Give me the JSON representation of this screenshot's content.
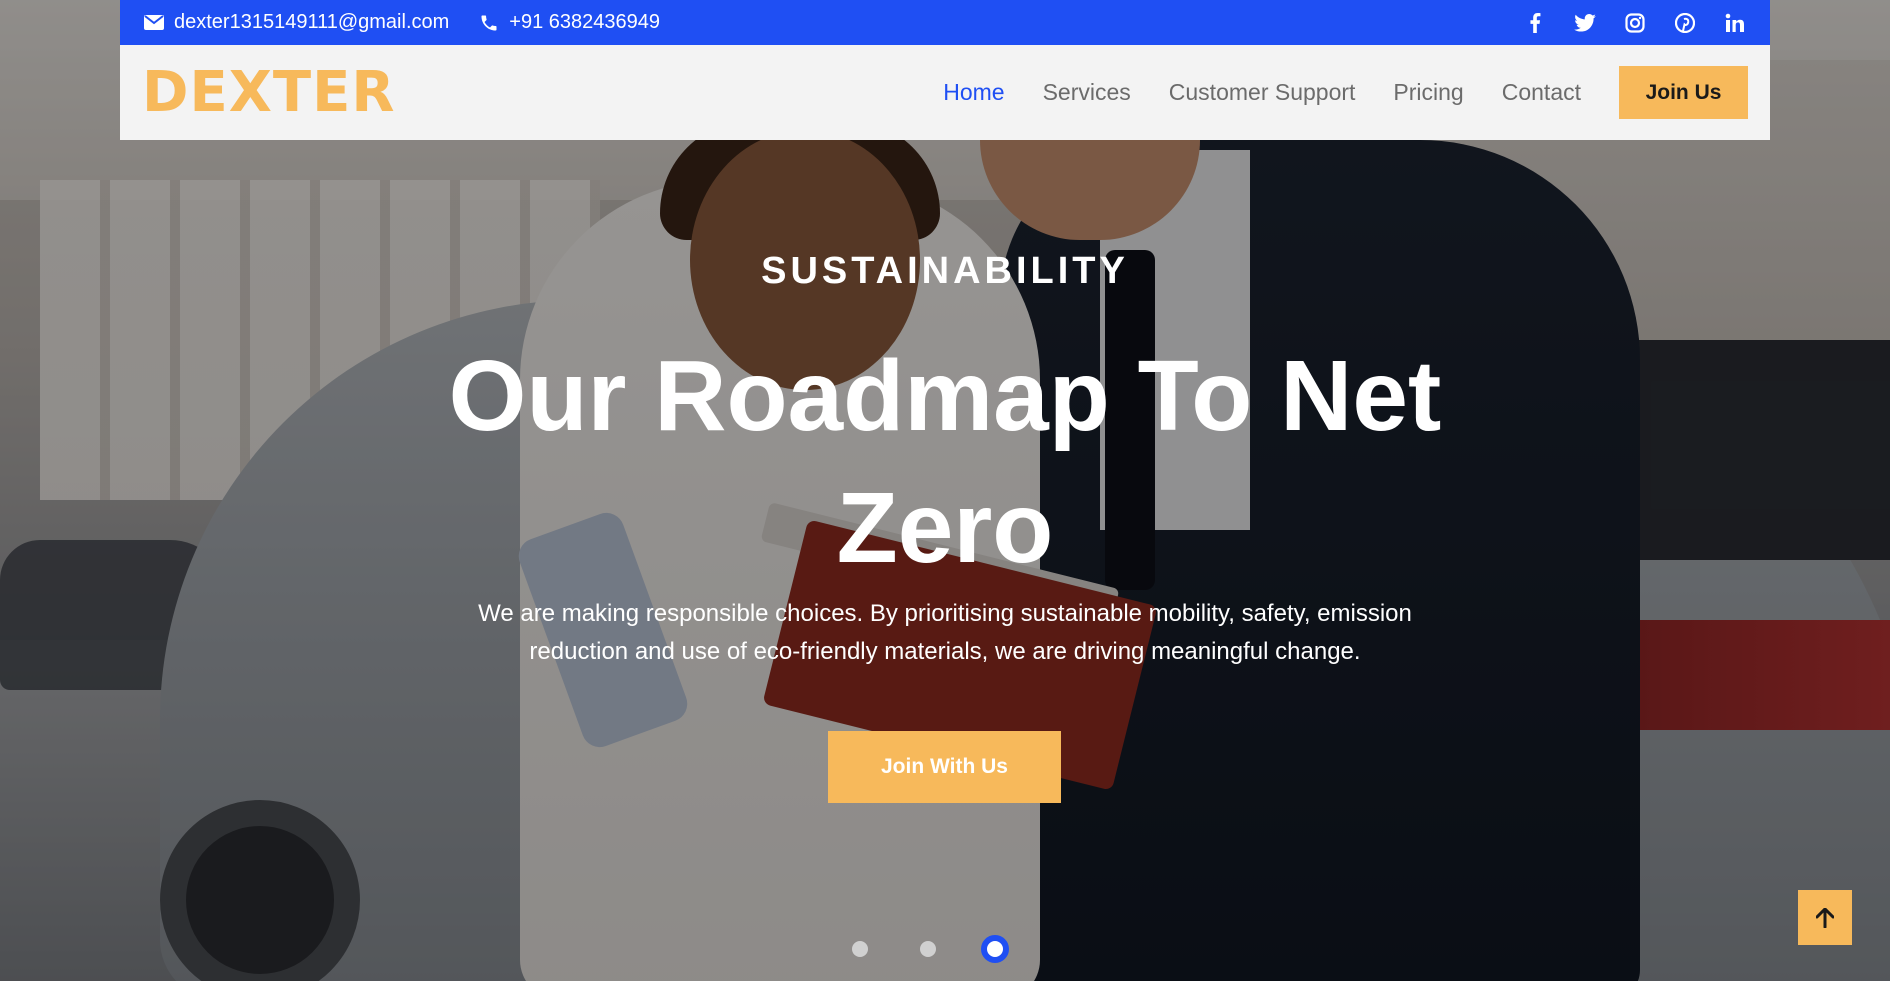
{
  "topbar": {
    "email": "dexter1315149111@gmail.com",
    "phone": "+91 6382436949",
    "socials": [
      {
        "name": "facebook",
        "glyph": "f"
      },
      {
        "name": "twitter",
        "glyph": "t"
      },
      {
        "name": "instagram",
        "glyph": "ig"
      },
      {
        "name": "pinterest",
        "glyph": "p"
      },
      {
        "name": "linkedin",
        "glyph": "in"
      }
    ]
  },
  "navbar": {
    "logo": "DEXTER",
    "links": [
      {
        "label": "Home",
        "active": true
      },
      {
        "label": "Services",
        "active": false
      },
      {
        "label": "Customer Support",
        "active": false
      },
      {
        "label": "Pricing",
        "active": false
      },
      {
        "label": "Contact",
        "active": false
      }
    ],
    "join_label": "Join Us"
  },
  "hero": {
    "eyebrow": "SUSTAINABILITY",
    "headline_line1": "Our Roadmap To Net",
    "headline_line2": "Zero",
    "lead_line1": "We are making responsible choices. By prioritising sustainable mobility, safety, emission",
    "lead_line2": "reduction and use of eco-friendly materials, we are driving meaningful change.",
    "cta_label": "Join With Us"
  },
  "carousel": {
    "slide_count": 3,
    "active_index": 2
  },
  "colors": {
    "primary_blue": "#1f4ff3",
    "accent_orange": "#f7b95b",
    "nav_bg": "#f3f3f3"
  },
  "icons": {
    "email": "envelope-icon",
    "phone": "phone-icon",
    "back_to_top": "arrow-up-icon"
  }
}
